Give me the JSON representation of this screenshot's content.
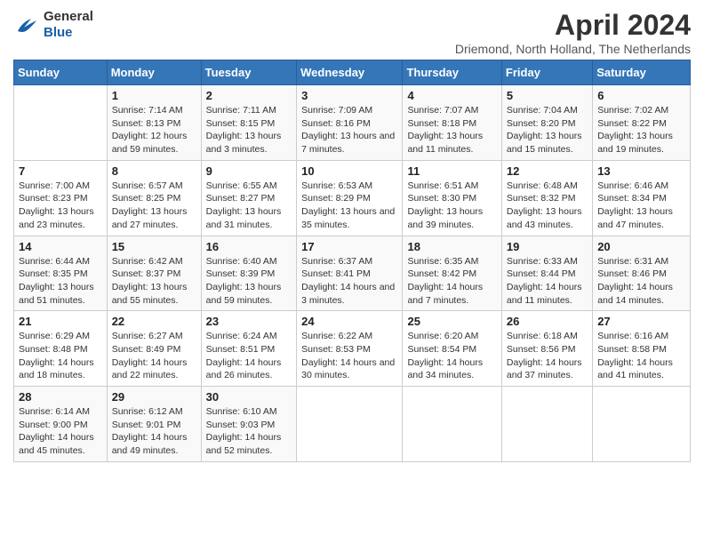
{
  "header": {
    "logo_general": "General",
    "logo_blue": "Blue",
    "title": "April 2024",
    "subtitle": "Driemond, North Holland, The Netherlands"
  },
  "weekdays": [
    "Sunday",
    "Monday",
    "Tuesday",
    "Wednesday",
    "Thursday",
    "Friday",
    "Saturday"
  ],
  "weeks": [
    [
      {
        "day": "",
        "sunrise": "",
        "sunset": "",
        "daylight": ""
      },
      {
        "day": "1",
        "sunrise": "Sunrise: 7:14 AM",
        "sunset": "Sunset: 8:13 PM",
        "daylight": "Daylight: 12 hours and 59 minutes."
      },
      {
        "day": "2",
        "sunrise": "Sunrise: 7:11 AM",
        "sunset": "Sunset: 8:15 PM",
        "daylight": "Daylight: 13 hours and 3 minutes."
      },
      {
        "day": "3",
        "sunrise": "Sunrise: 7:09 AM",
        "sunset": "Sunset: 8:16 PM",
        "daylight": "Daylight: 13 hours and 7 minutes."
      },
      {
        "day": "4",
        "sunrise": "Sunrise: 7:07 AM",
        "sunset": "Sunset: 8:18 PM",
        "daylight": "Daylight: 13 hours and 11 minutes."
      },
      {
        "day": "5",
        "sunrise": "Sunrise: 7:04 AM",
        "sunset": "Sunset: 8:20 PM",
        "daylight": "Daylight: 13 hours and 15 minutes."
      },
      {
        "day": "6",
        "sunrise": "Sunrise: 7:02 AM",
        "sunset": "Sunset: 8:22 PM",
        "daylight": "Daylight: 13 hours and 19 minutes."
      }
    ],
    [
      {
        "day": "7",
        "sunrise": "Sunrise: 7:00 AM",
        "sunset": "Sunset: 8:23 PM",
        "daylight": "Daylight: 13 hours and 23 minutes."
      },
      {
        "day": "8",
        "sunrise": "Sunrise: 6:57 AM",
        "sunset": "Sunset: 8:25 PM",
        "daylight": "Daylight: 13 hours and 27 minutes."
      },
      {
        "day": "9",
        "sunrise": "Sunrise: 6:55 AM",
        "sunset": "Sunset: 8:27 PM",
        "daylight": "Daylight: 13 hours and 31 minutes."
      },
      {
        "day": "10",
        "sunrise": "Sunrise: 6:53 AM",
        "sunset": "Sunset: 8:29 PM",
        "daylight": "Daylight: 13 hours and 35 minutes."
      },
      {
        "day": "11",
        "sunrise": "Sunrise: 6:51 AM",
        "sunset": "Sunset: 8:30 PM",
        "daylight": "Daylight: 13 hours and 39 minutes."
      },
      {
        "day": "12",
        "sunrise": "Sunrise: 6:48 AM",
        "sunset": "Sunset: 8:32 PM",
        "daylight": "Daylight: 13 hours and 43 minutes."
      },
      {
        "day": "13",
        "sunrise": "Sunrise: 6:46 AM",
        "sunset": "Sunset: 8:34 PM",
        "daylight": "Daylight: 13 hours and 47 minutes."
      }
    ],
    [
      {
        "day": "14",
        "sunrise": "Sunrise: 6:44 AM",
        "sunset": "Sunset: 8:35 PM",
        "daylight": "Daylight: 13 hours and 51 minutes."
      },
      {
        "day": "15",
        "sunrise": "Sunrise: 6:42 AM",
        "sunset": "Sunset: 8:37 PM",
        "daylight": "Daylight: 13 hours and 55 minutes."
      },
      {
        "day": "16",
        "sunrise": "Sunrise: 6:40 AM",
        "sunset": "Sunset: 8:39 PM",
        "daylight": "Daylight: 13 hours and 59 minutes."
      },
      {
        "day": "17",
        "sunrise": "Sunrise: 6:37 AM",
        "sunset": "Sunset: 8:41 PM",
        "daylight": "Daylight: 14 hours and 3 minutes."
      },
      {
        "day": "18",
        "sunrise": "Sunrise: 6:35 AM",
        "sunset": "Sunset: 8:42 PM",
        "daylight": "Daylight: 14 hours and 7 minutes."
      },
      {
        "day": "19",
        "sunrise": "Sunrise: 6:33 AM",
        "sunset": "Sunset: 8:44 PM",
        "daylight": "Daylight: 14 hours and 11 minutes."
      },
      {
        "day": "20",
        "sunrise": "Sunrise: 6:31 AM",
        "sunset": "Sunset: 8:46 PM",
        "daylight": "Daylight: 14 hours and 14 minutes."
      }
    ],
    [
      {
        "day": "21",
        "sunrise": "Sunrise: 6:29 AM",
        "sunset": "Sunset: 8:48 PM",
        "daylight": "Daylight: 14 hours and 18 minutes."
      },
      {
        "day": "22",
        "sunrise": "Sunrise: 6:27 AM",
        "sunset": "Sunset: 8:49 PM",
        "daylight": "Daylight: 14 hours and 22 minutes."
      },
      {
        "day": "23",
        "sunrise": "Sunrise: 6:24 AM",
        "sunset": "Sunset: 8:51 PM",
        "daylight": "Daylight: 14 hours and 26 minutes."
      },
      {
        "day": "24",
        "sunrise": "Sunrise: 6:22 AM",
        "sunset": "Sunset: 8:53 PM",
        "daylight": "Daylight: 14 hours and 30 minutes."
      },
      {
        "day": "25",
        "sunrise": "Sunrise: 6:20 AM",
        "sunset": "Sunset: 8:54 PM",
        "daylight": "Daylight: 14 hours and 34 minutes."
      },
      {
        "day": "26",
        "sunrise": "Sunrise: 6:18 AM",
        "sunset": "Sunset: 8:56 PM",
        "daylight": "Daylight: 14 hours and 37 minutes."
      },
      {
        "day": "27",
        "sunrise": "Sunrise: 6:16 AM",
        "sunset": "Sunset: 8:58 PM",
        "daylight": "Daylight: 14 hours and 41 minutes."
      }
    ],
    [
      {
        "day": "28",
        "sunrise": "Sunrise: 6:14 AM",
        "sunset": "Sunset: 9:00 PM",
        "daylight": "Daylight: 14 hours and 45 minutes."
      },
      {
        "day": "29",
        "sunrise": "Sunrise: 6:12 AM",
        "sunset": "Sunset: 9:01 PM",
        "daylight": "Daylight: 14 hours and 49 minutes."
      },
      {
        "day": "30",
        "sunrise": "Sunrise: 6:10 AM",
        "sunset": "Sunset: 9:03 PM",
        "daylight": "Daylight: 14 hours and 52 minutes."
      },
      {
        "day": "",
        "sunrise": "",
        "sunset": "",
        "daylight": ""
      },
      {
        "day": "",
        "sunrise": "",
        "sunset": "",
        "daylight": ""
      },
      {
        "day": "",
        "sunrise": "",
        "sunset": "",
        "daylight": ""
      },
      {
        "day": "",
        "sunrise": "",
        "sunset": "",
        "daylight": ""
      }
    ]
  ]
}
